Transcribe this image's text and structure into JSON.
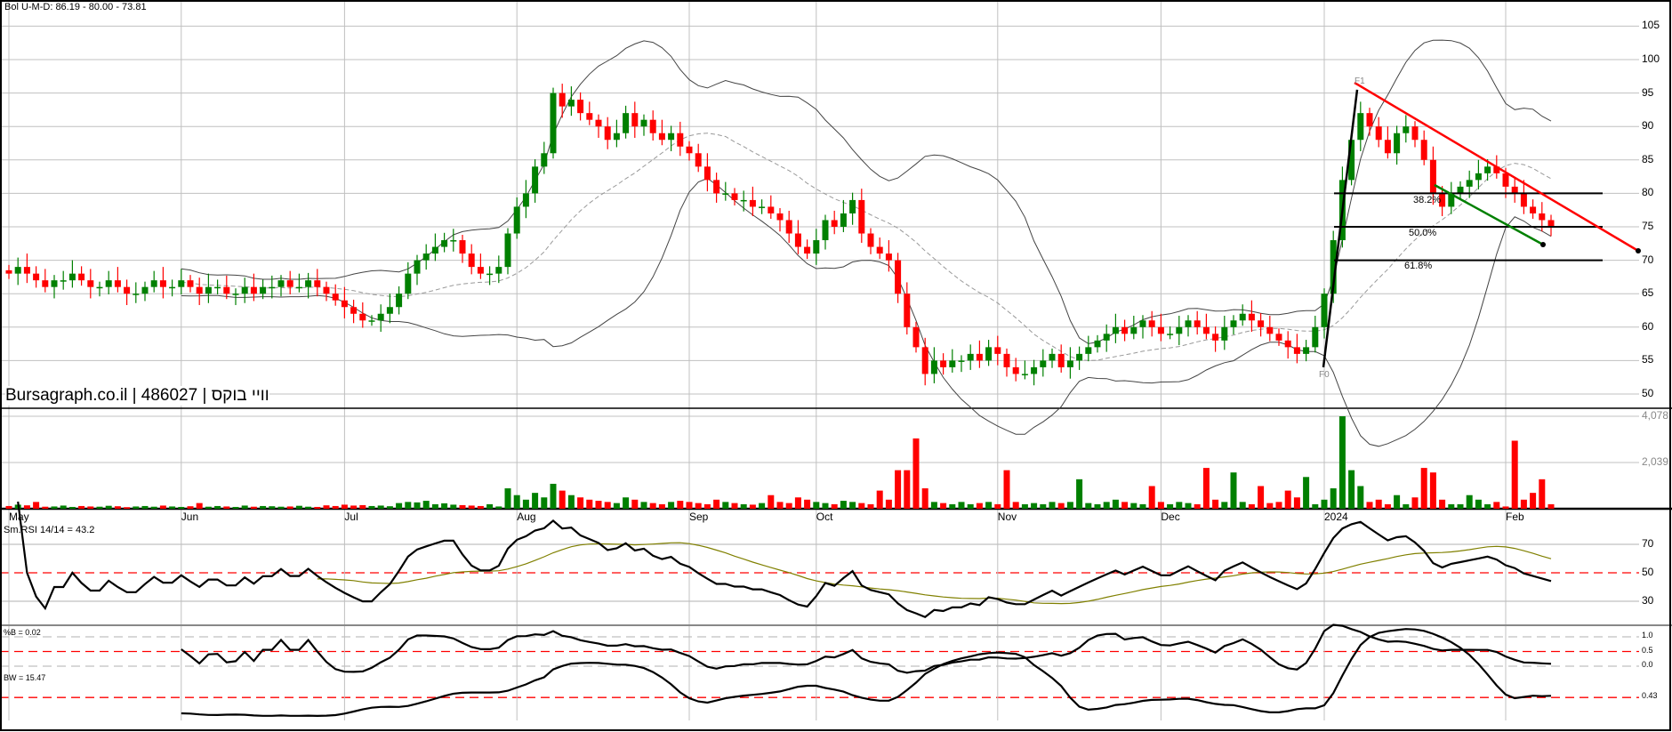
{
  "header": {
    "bollinger_label": "Bol U-M-D: 86.19 - 80.00 - 73.81"
  },
  "watermark": "Bursagraph.co.il | 486027 | וויי בוקס",
  "rsi_label": "Sm.RSI 14/14 = 43.2",
  "pctb_label": "%B = 0.02",
  "bw_label": "BW = 15.47",
  "fib": {
    "f0": "F0",
    "f1": "F1",
    "l382": "38.2%",
    "l500": "50.0%",
    "l618": "61.8%"
  },
  "colors": {
    "up": "#008000",
    "down": "#ff0000",
    "grid": "#c0c0c0",
    "rsi_signal": "#808000"
  },
  "chart_data": {
    "type": "candlestick",
    "title": "Bol U-M-D: 86.19 - 80.00 - 73.81",
    "price_ticks": [
      "105",
      "100",
      "95",
      "90",
      "85",
      "80",
      "75",
      "70",
      "65",
      "60",
      "55",
      "50"
    ],
    "price_range": [
      50,
      105
    ],
    "volume_ticks": [
      "4,078",
      "2,039"
    ],
    "rsi_ticks": [
      "70",
      "50",
      "30"
    ],
    "pctb_ticks": [
      "1.0",
      "0.5",
      "0.0"
    ],
    "bw_ticks": [
      "0.43"
    ],
    "months": [
      {
        "label": "May",
        "index": 0
      },
      {
        "label": "Jun",
        "index": 19
      },
      {
        "label": "Jul",
        "index": 37
      },
      {
        "label": "Aug",
        "index": 56
      },
      {
        "label": "Sep",
        "index": 75
      },
      {
        "label": "Oct",
        "index": 89
      },
      {
        "label": "Nov",
        "index": 109
      },
      {
        "label": "Dec",
        "index": 127
      },
      {
        "label": "2024",
        "index": 145
      },
      {
        "label": "Feb",
        "index": 165
      }
    ],
    "close": [
      68,
      69,
      68,
      67,
      66,
      67,
      67,
      68,
      67,
      66,
      66,
      67,
      66,
      65,
      65,
      66,
      67,
      66,
      66,
      67,
      66,
      65,
      66,
      66,
      65,
      65,
      66,
      65,
      66,
      66,
      67,
      66,
      66,
      67,
      66,
      65,
      64,
      63,
      62,
      61,
      61,
      62,
      63,
      65,
      68,
      70,
      71,
      72,
      73,
      73,
      71,
      69,
      68,
      68,
      69,
      74,
      78,
      80,
      84,
      86,
      95,
      93,
      94,
      92,
      91,
      90,
      88,
      89,
      92,
      90,
      91,
      89,
      88,
      89,
      87,
      86,
      84,
      82,
      80,
      80,
      79,
      79,
      78,
      78,
      77,
      76,
      74,
      72,
      71,
      73,
      76,
      75,
      77,
      79,
      74,
      72,
      71,
      70,
      65,
      60,
      57,
      53,
      55,
      54,
      55,
      55,
      56,
      55,
      57,
      56,
      54,
      53,
      53,
      54,
      55,
      56,
      54,
      55,
      56,
      57,
      58,
      59,
      60,
      59,
      60,
      61,
      60,
      59,
      59,
      60,
      61,
      60,
      59,
      58,
      60,
      61,
      62,
      61,
      60,
      59,
      58,
      57,
      56,
      57,
      60,
      65,
      73,
      82,
      88,
      92,
      90,
      88,
      86,
      89,
      90,
      88,
      85,
      80,
      78,
      80,
      81,
      82,
      83,
      84,
      83,
      81,
      80,
      78,
      77,
      76,
      75
    ],
    "volume": [
      120,
      180,
      150,
      300,
      90,
      100,
      140,
      80,
      120,
      100,
      90,
      130,
      110,
      70,
      100,
      120,
      90,
      140,
      100,
      80,
      110,
      250,
      90,
      120,
      100,
      80,
      140,
      90,
      120,
      110,
      90,
      100,
      130,
      90,
      80,
      150,
      120,
      180,
      140,
      160,
      120,
      140,
      110,
      250,
      300,
      280,
      350,
      200,
      240,
      180,
      160,
      140,
      120,
      200,
      100,
      900,
      600,
      400,
      700,
      500,
      1100,
      800,
      600,
      500,
      400,
      350,
      300,
      250,
      500,
      400,
      300,
      250,
      200,
      300,
      350,
      300,
      250,
      200,
      400,
      300,
      250,
      200,
      180,
      250,
      600,
      300,
      250,
      500,
      400,
      300,
      250,
      200,
      350,
      300,
      250,
      200,
      800,
      400,
      1700,
      1700,
      3100,
      900,
      300,
      250,
      200,
      300,
      200,
      250,
      300,
      200,
      1700,
      300,
      200,
      250,
      200,
      300,
      250,
      300,
      1300,
      250,
      200,
      300,
      400,
      300,
      250,
      200,
      1000,
      300,
      200,
      300,
      250,
      200,
      1800,
      400,
      300,
      1600,
      300,
      200,
      1000,
      250,
      300,
      800,
      500,
      1400,
      200,
      400,
      900,
      4078,
      1700,
      1000,
      300,
      400,
      200,
      600,
      200,
      500,
      1800,
      1600,
      400,
      200,
      200,
      600,
      400,
      200,
      300,
      100,
      3000,
      400,
      700,
      1300,
      200
    ]
  }
}
